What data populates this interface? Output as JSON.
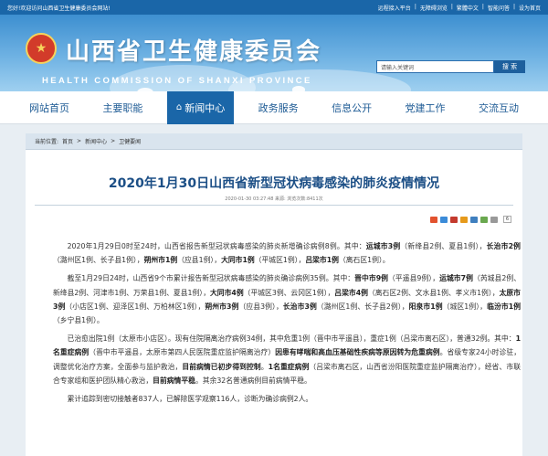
{
  "topbar": {
    "welcome": "您好!欢迎访问山西省卫生健康委员会网站!",
    "links": [
      "远程接入平台",
      "无障碍浏览",
      "繁體中文",
      "智能问答",
      "设为首页"
    ]
  },
  "header": {
    "title_cn": "山西省卫生健康委员会",
    "title_en": "HEALTH COMMISSION OF SHANXI PROVINCE",
    "search_placeholder": "请输入关键词",
    "search_button": "搜 索"
  },
  "nav": {
    "items": [
      "网站首页",
      "主要职能",
      "新闻中心",
      "政务服务",
      "信息公开",
      "党建工作",
      "交流互动"
    ],
    "active_index": 2
  },
  "breadcrumb": {
    "label": "当前位置:",
    "items": [
      "首页",
      "新闻中心",
      "卫健要闻"
    ],
    "sep": ">"
  },
  "article": {
    "title": "2020年1月30日山西省新型冠状病毒感染的肺炎疫情情况",
    "meta": "2020-01-30 03:27:48   来源:         浏览次数:8411次",
    "share_count": "6",
    "share_colors": [
      "#e2522e",
      "#3b8bd8",
      "#c43a2e",
      "#e69a1b",
      "#3f7fbf",
      "#6aa84f",
      "#999999"
    ],
    "para1_html": "2020年1月29日0时至24时，山西省报告新型冠状病毒感染的肺炎新增确诊病例8例。其中：<b>运城市3例</b>（新绛县2例、夏县1例），<b>长治市2例</b>（潞州区1例、长子县1例），<b>朔州市1例</b>（应县1例），<b>大同市1例</b>（平城区1例），<b>吕梁市1例</b>（离石区1例）。",
    "para2_html": "截至1月29日24时，山西省9个市累计报告新型冠状病毒感染的肺炎确诊病例35例。其中：<b>晋中市9例</b>（平遥县9例），<b>运城市7例</b>（芮城县2例、新绛县2例、河津市1例、万荣县1例、夏县1例），<b>大同市4例</b>（平城区3例、云冈区1例），<b>吕梁市4例</b>（离石区2例、文水县1例、孝义市1例），<b>太原市3例</b>（小店区1例、迎泽区1例、万柏林区1例），<b>朔州市3例</b>（应县3例），<b>长治市3例</b>（潞州区1例、长子县2例），<b>阳泉市1例</b>（城区1例），<b>临汾市1例</b>（乡宁县1例）。",
    "para3_html": "已治愈出院1例（太原市小店区）。现有住院隔离治疗病例34例，其中危重1例（晋中市平遥县），重症1例（吕梁市离石区），普通32例。其中：<b>1名重症病例</b>（晋中市平遥县，太原市第四人民医院重症监护隔离治疗）<b>因患有哮喘和高血压基础性疾病等原因转为危重病例</b>。省级专家24小时诊驻，调整优化治疗方案，全面参与监护救治，<b>目前病情已初步得到控制</b>。<b>1名重症病例</b>（吕梁市离石区，山西省汾阳医院重症监护隔离治疗），经省、市联合专家组和医护团队精心救治，<b>目前病情平稳</b>。其余32名普通病例目前病情平稳。",
    "para4_html": "累计追踪到密切接触者837人，已解除医学观察116人，诊断为确诊病例2人。"
  }
}
